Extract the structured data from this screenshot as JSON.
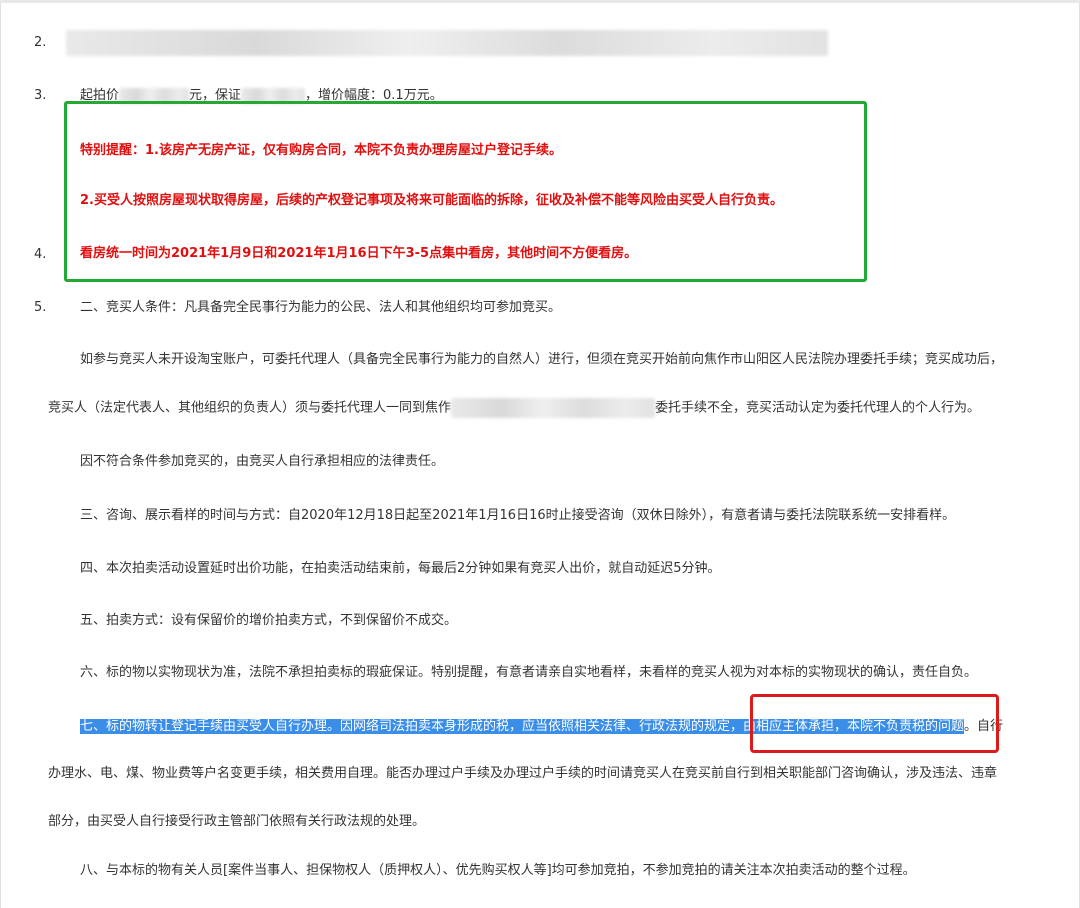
{
  "items": {
    "n2": "2.",
    "n3": "3.",
    "n4": "4.",
    "n5": "5."
  },
  "line3": {
    "a": "起拍价",
    "b": "元，保证",
    "c": "，增价幅度：0.1万元。"
  },
  "notice": {
    "l1": "特别提醒：1.该房产无房产证，仅有购房合同，本院不负责办理房屋过户登记手续。",
    "l2": "2.买受人按照房屋现状取得房屋，后续的产权登记事项及将来可能面临的拆除，征收及补偿不能等风险由买受人自行负责。",
    "l3": "看房统一时间为2021年1月9日和2021年1月16日下午3-5点集中看房，其他时间不方便看房。"
  },
  "body": {
    "p5": "二、竞买人条件：凡具备完全民事行为能力的公民、法人和其他组织均可参加竞买。",
    "p6": "如参与竞买人未开设淘宝账户，可委托代理人（具备完全民事行为能力的自然人）进行，但须在竞买开始前向焦作市山阳区人民法院办理委托手续；竞买成功后，",
    "p7a": "竞买人（法定代表人、其他组织的负责人）须与委托代理人一同到焦作",
    "p7b": "委托手续不全，竞买活动认定为委托代理人的个人行为。",
    "p8": "因不符合条件参加竞买的，由竞买人自行承担相应的法律责任。",
    "p9": "三、咨询、展示看样的时间与方式：自2020年12月18日起至2021年1月16日16时止接受咨询（双休日除外），有意者请与委托法院联系统一安排看样。",
    "p10": "四、本次拍卖活动设置延时出价功能，在拍卖活动结束前，每最后2分钟如果有竞买人出价，就自动延迟5分钟。",
    "p11": "五、拍卖方式：设有保留价的增价拍卖方式，不到保留价不成交。",
    "p12": "六、标的物以实物现状为准，法院不承担拍卖标的瑕疵保证。特别提醒，有意者请亲自实地看样，未看样的竞买人视为对本标的实物现状的确认，责任自负。",
    "p13a": "七、",
    "p13b": "标的物转让登记手续由买受人自行办理。因网络司法拍卖本身形成的税，应当依照相关法律、行政法规的规定，由相应主体承担，本院不负责税的问题",
    "p13c": "。自行",
    "p14": "办理水、电、煤、物业费等户名变更手续，相关费用自理。能否办理过户手续及办理过户手续的时间请竞买人在竞买前自行到相关职能部门咨询确认，涉及违法、违章",
    "p15": "部分，由买受人自行接受行政主管部门依照有关行政法规的处理。",
    "p16": "八、与本标的物有关人员[案件当事人、担保物权人（质押权人）、优先购买权人等]均可参加竞拍，不参加竞拍的请关注本次拍卖活动的整个过程。"
  }
}
